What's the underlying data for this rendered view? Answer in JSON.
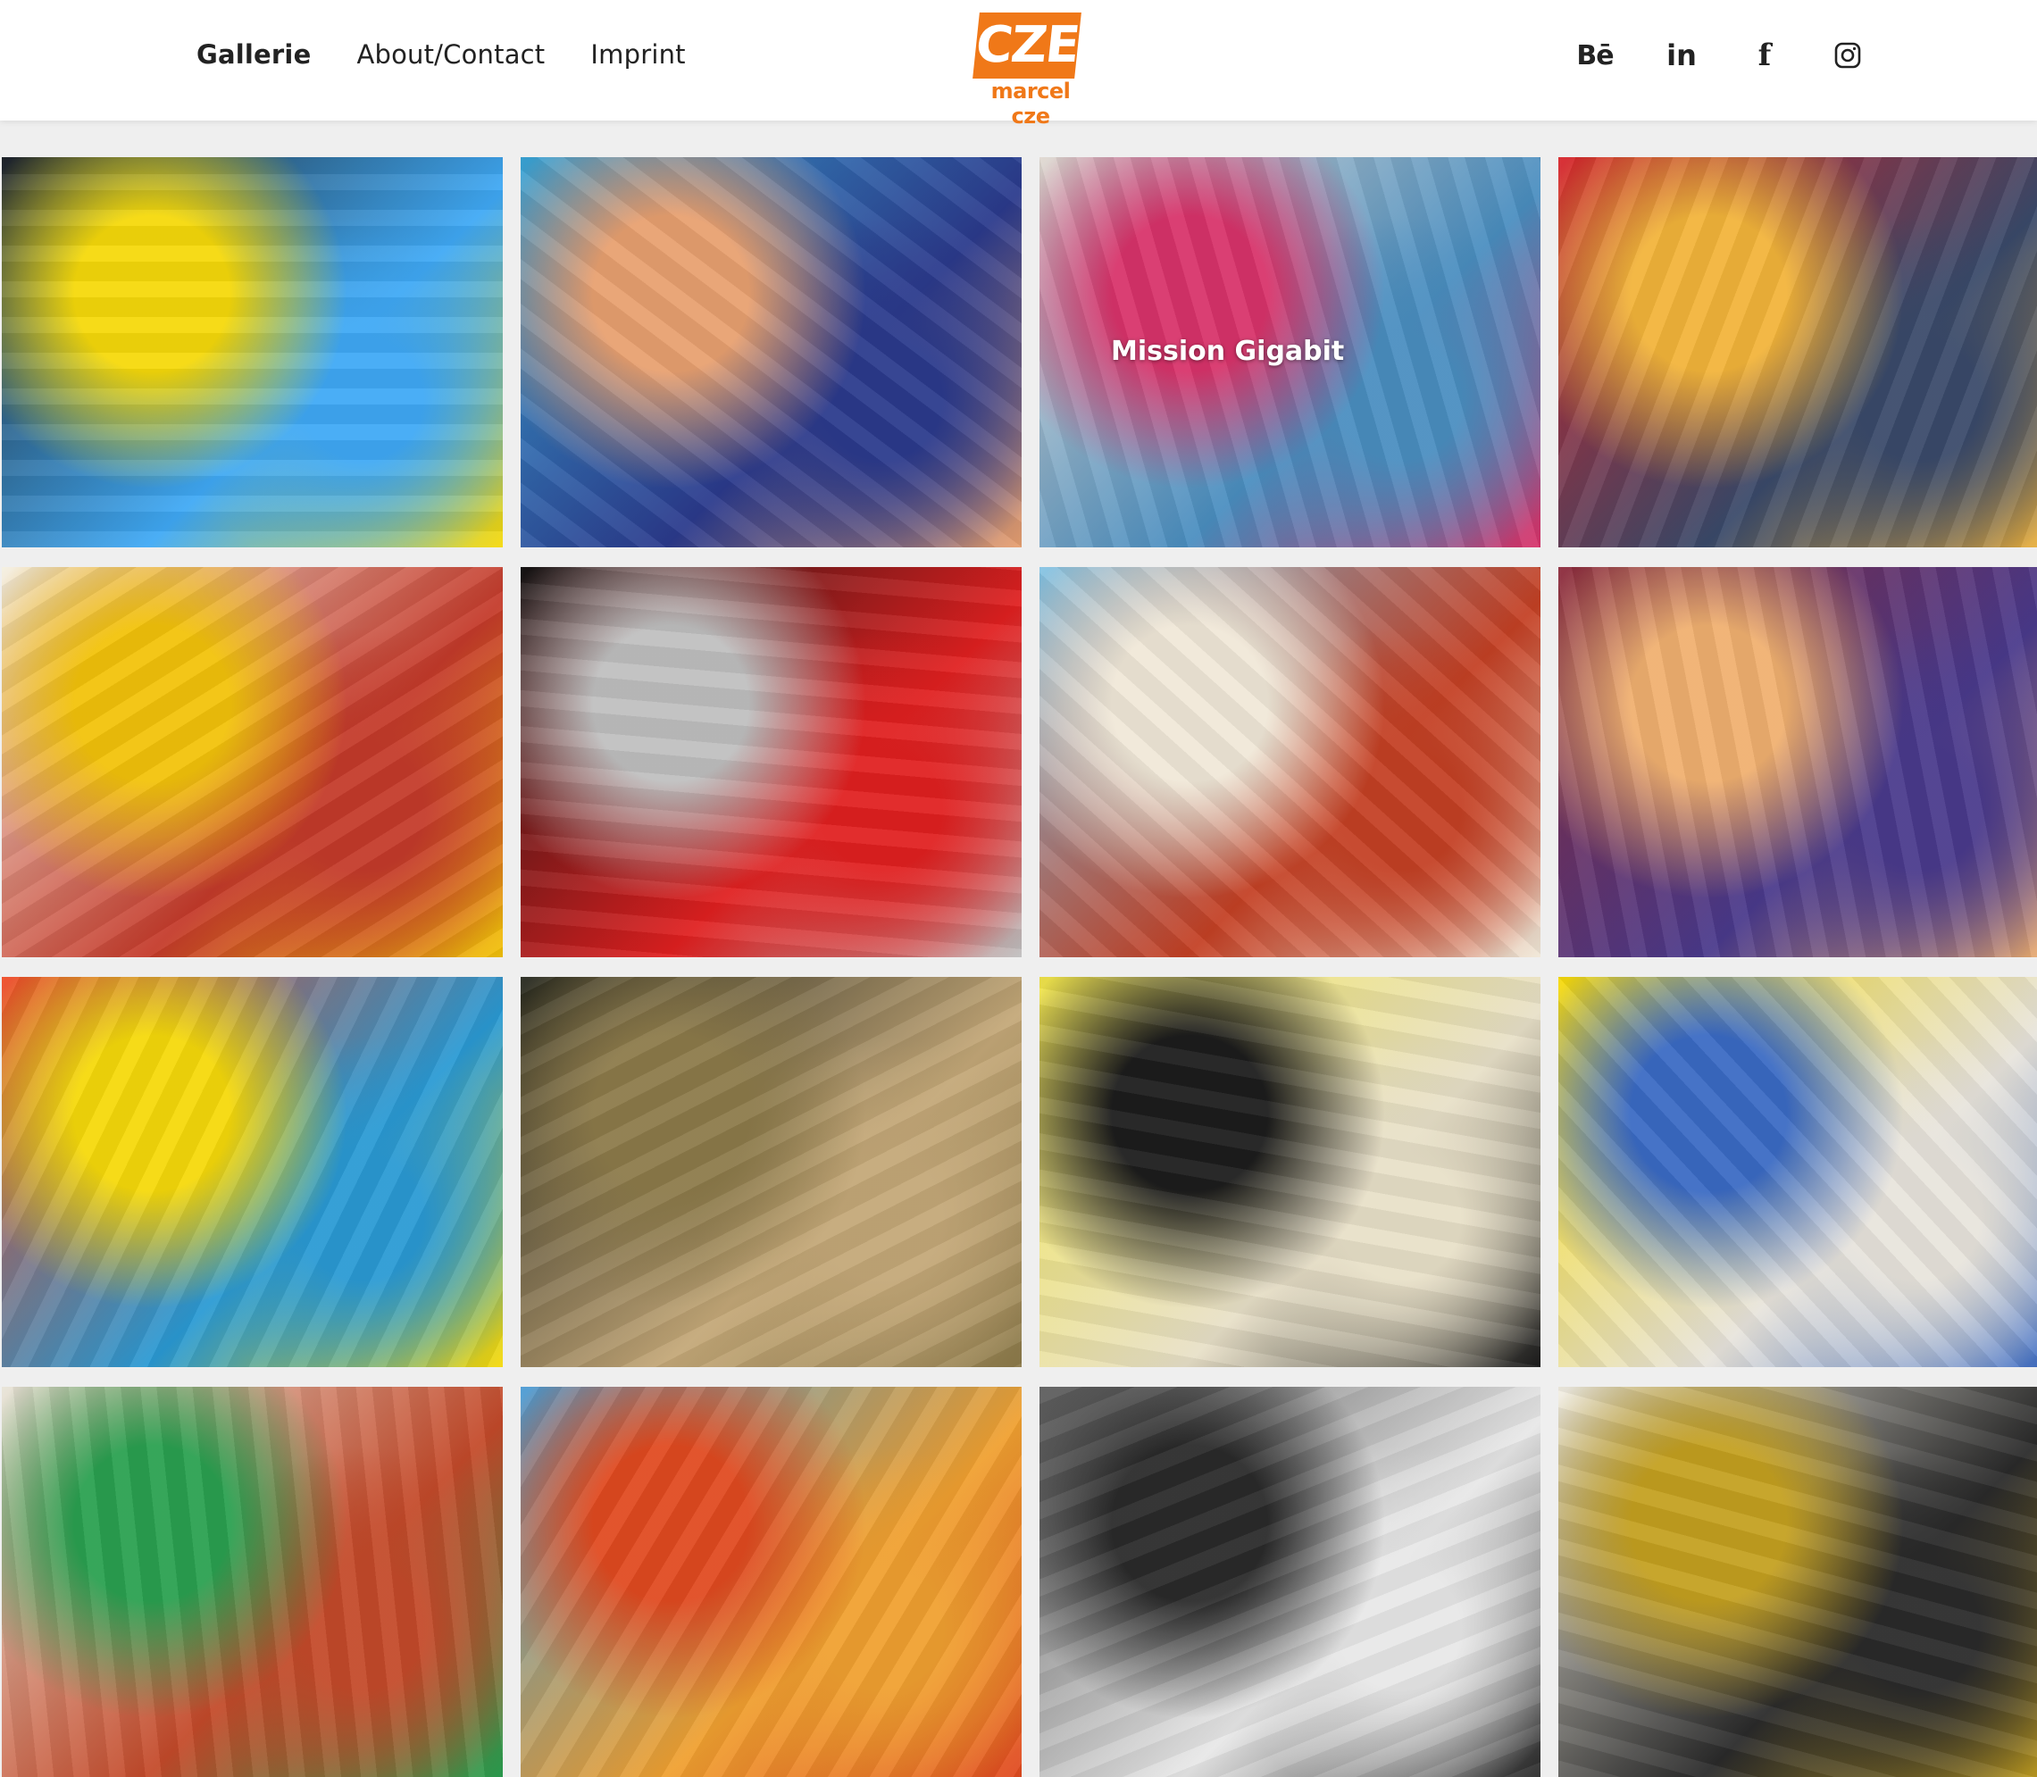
{
  "nav": {
    "items": [
      {
        "label": "Gallerie",
        "active": true
      },
      {
        "label": "About/Contact",
        "active": false
      },
      {
        "label": "Imprint",
        "active": false
      }
    ]
  },
  "logo": {
    "mark": "CZE",
    "subtitle": "marcel cze",
    "color": "#f07818"
  },
  "social": {
    "behance": "Bē",
    "linkedin": "in",
    "facebook": "f",
    "icons": [
      "behance-icon",
      "linkedin-icon",
      "facebook-icon",
      "instagram-icon"
    ]
  },
  "gallery": {
    "tiles": [
      {
        "name": "things-happen-mural",
        "colors": [
          "#20242a",
          "#f5d90a",
          "#3fa9f5"
        ]
      },
      {
        "name": "duesseldorf-carnival-float",
        "colors": [
          "#3aa6d8",
          "#e8a070",
          "#2b3a8c"
        ]
      },
      {
        "name": "mission-gigabit-paint-cups",
        "colors": [
          "#e0d8d0",
          "#d8336a",
          "#4a8ec0"
        ],
        "overlay": "Mission Gigabit"
      },
      {
        "name": "carnival-kiosk-parade",
        "colors": [
          "#d8242a",
          "#f2b43a",
          "#3a4a6a"
        ]
      },
      {
        "name": "ausgang-umleitung-sign",
        "colors": [
          "#f4f0e0",
          "#f2c20a",
          "#c43a2a"
        ]
      },
      {
        "name": "moon-chalkboard-zakk",
        "colors": [
          "#141414",
          "#bfbfbf",
          "#e02020"
        ]
      },
      {
        "name": "macht-man-das-heute-so",
        "colors": [
          "#84c4e4",
          "#f0e8d8",
          "#c44024"
        ]
      },
      {
        "name": "portrait-afro-painting",
        "colors": [
          "#8c2a3a",
          "#f0b070",
          "#4a3a8c"
        ]
      },
      {
        "name": "eyes-collage",
        "colors": [
          "#f04a24",
          "#f5d90a",
          "#2a9ad4"
        ]
      },
      {
        "name": "merkel-headphones",
        "colors": [
          "#24261c",
          "#8c7a4a",
          "#c4a878"
        ]
      },
      {
        "name": "goethe-sketch",
        "colors": [
          "#f2e64a",
          "#1c1c1c",
          "#e8e0c8"
        ]
      },
      {
        "name": "lightbulb-portrait",
        "colors": [
          "#f5d90a",
          "#3a6ac4",
          "#e8e4dc"
        ]
      },
      {
        "name": "betterfuture-wall",
        "colors": [
          "#e8e4d8",
          "#2aa050",
          "#c44a2a"
        ]
      },
      {
        "name": "dragon-carnival-float",
        "colors": [
          "#4a9ad4",
          "#e04a20",
          "#f0a030"
        ]
      },
      {
        "name": "miele-happiness",
        "colors": [
          "#5a5a5a",
          "#2a2a2a",
          "#e8e8e8"
        ],
        "overlay": ""
      },
      {
        "name": "rheinische-post-newspaper",
        "colors": [
          "#f4f0e4",
          "#c4a020",
          "#2a2a2a"
        ]
      }
    ]
  }
}
